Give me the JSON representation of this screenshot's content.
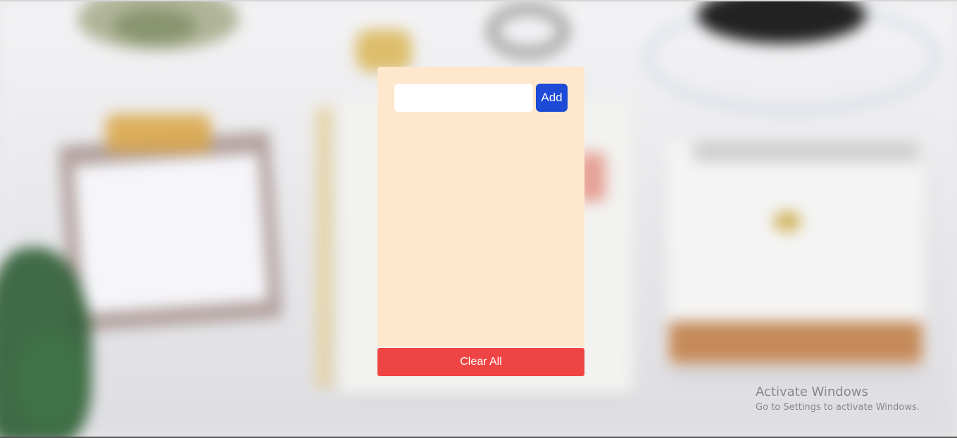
{
  "todo": {
    "input": {
      "value": "",
      "placeholder": ""
    },
    "add_label": "Add",
    "clear_label": "Clear All",
    "items": []
  },
  "watermark": {
    "title": "Activate Windows",
    "subtitle": "Go to Settings to activate Windows."
  },
  "colors": {
    "card_background": "#fee7cc",
    "add_button": "#1d4ad6",
    "clear_button": "#ef4444"
  }
}
